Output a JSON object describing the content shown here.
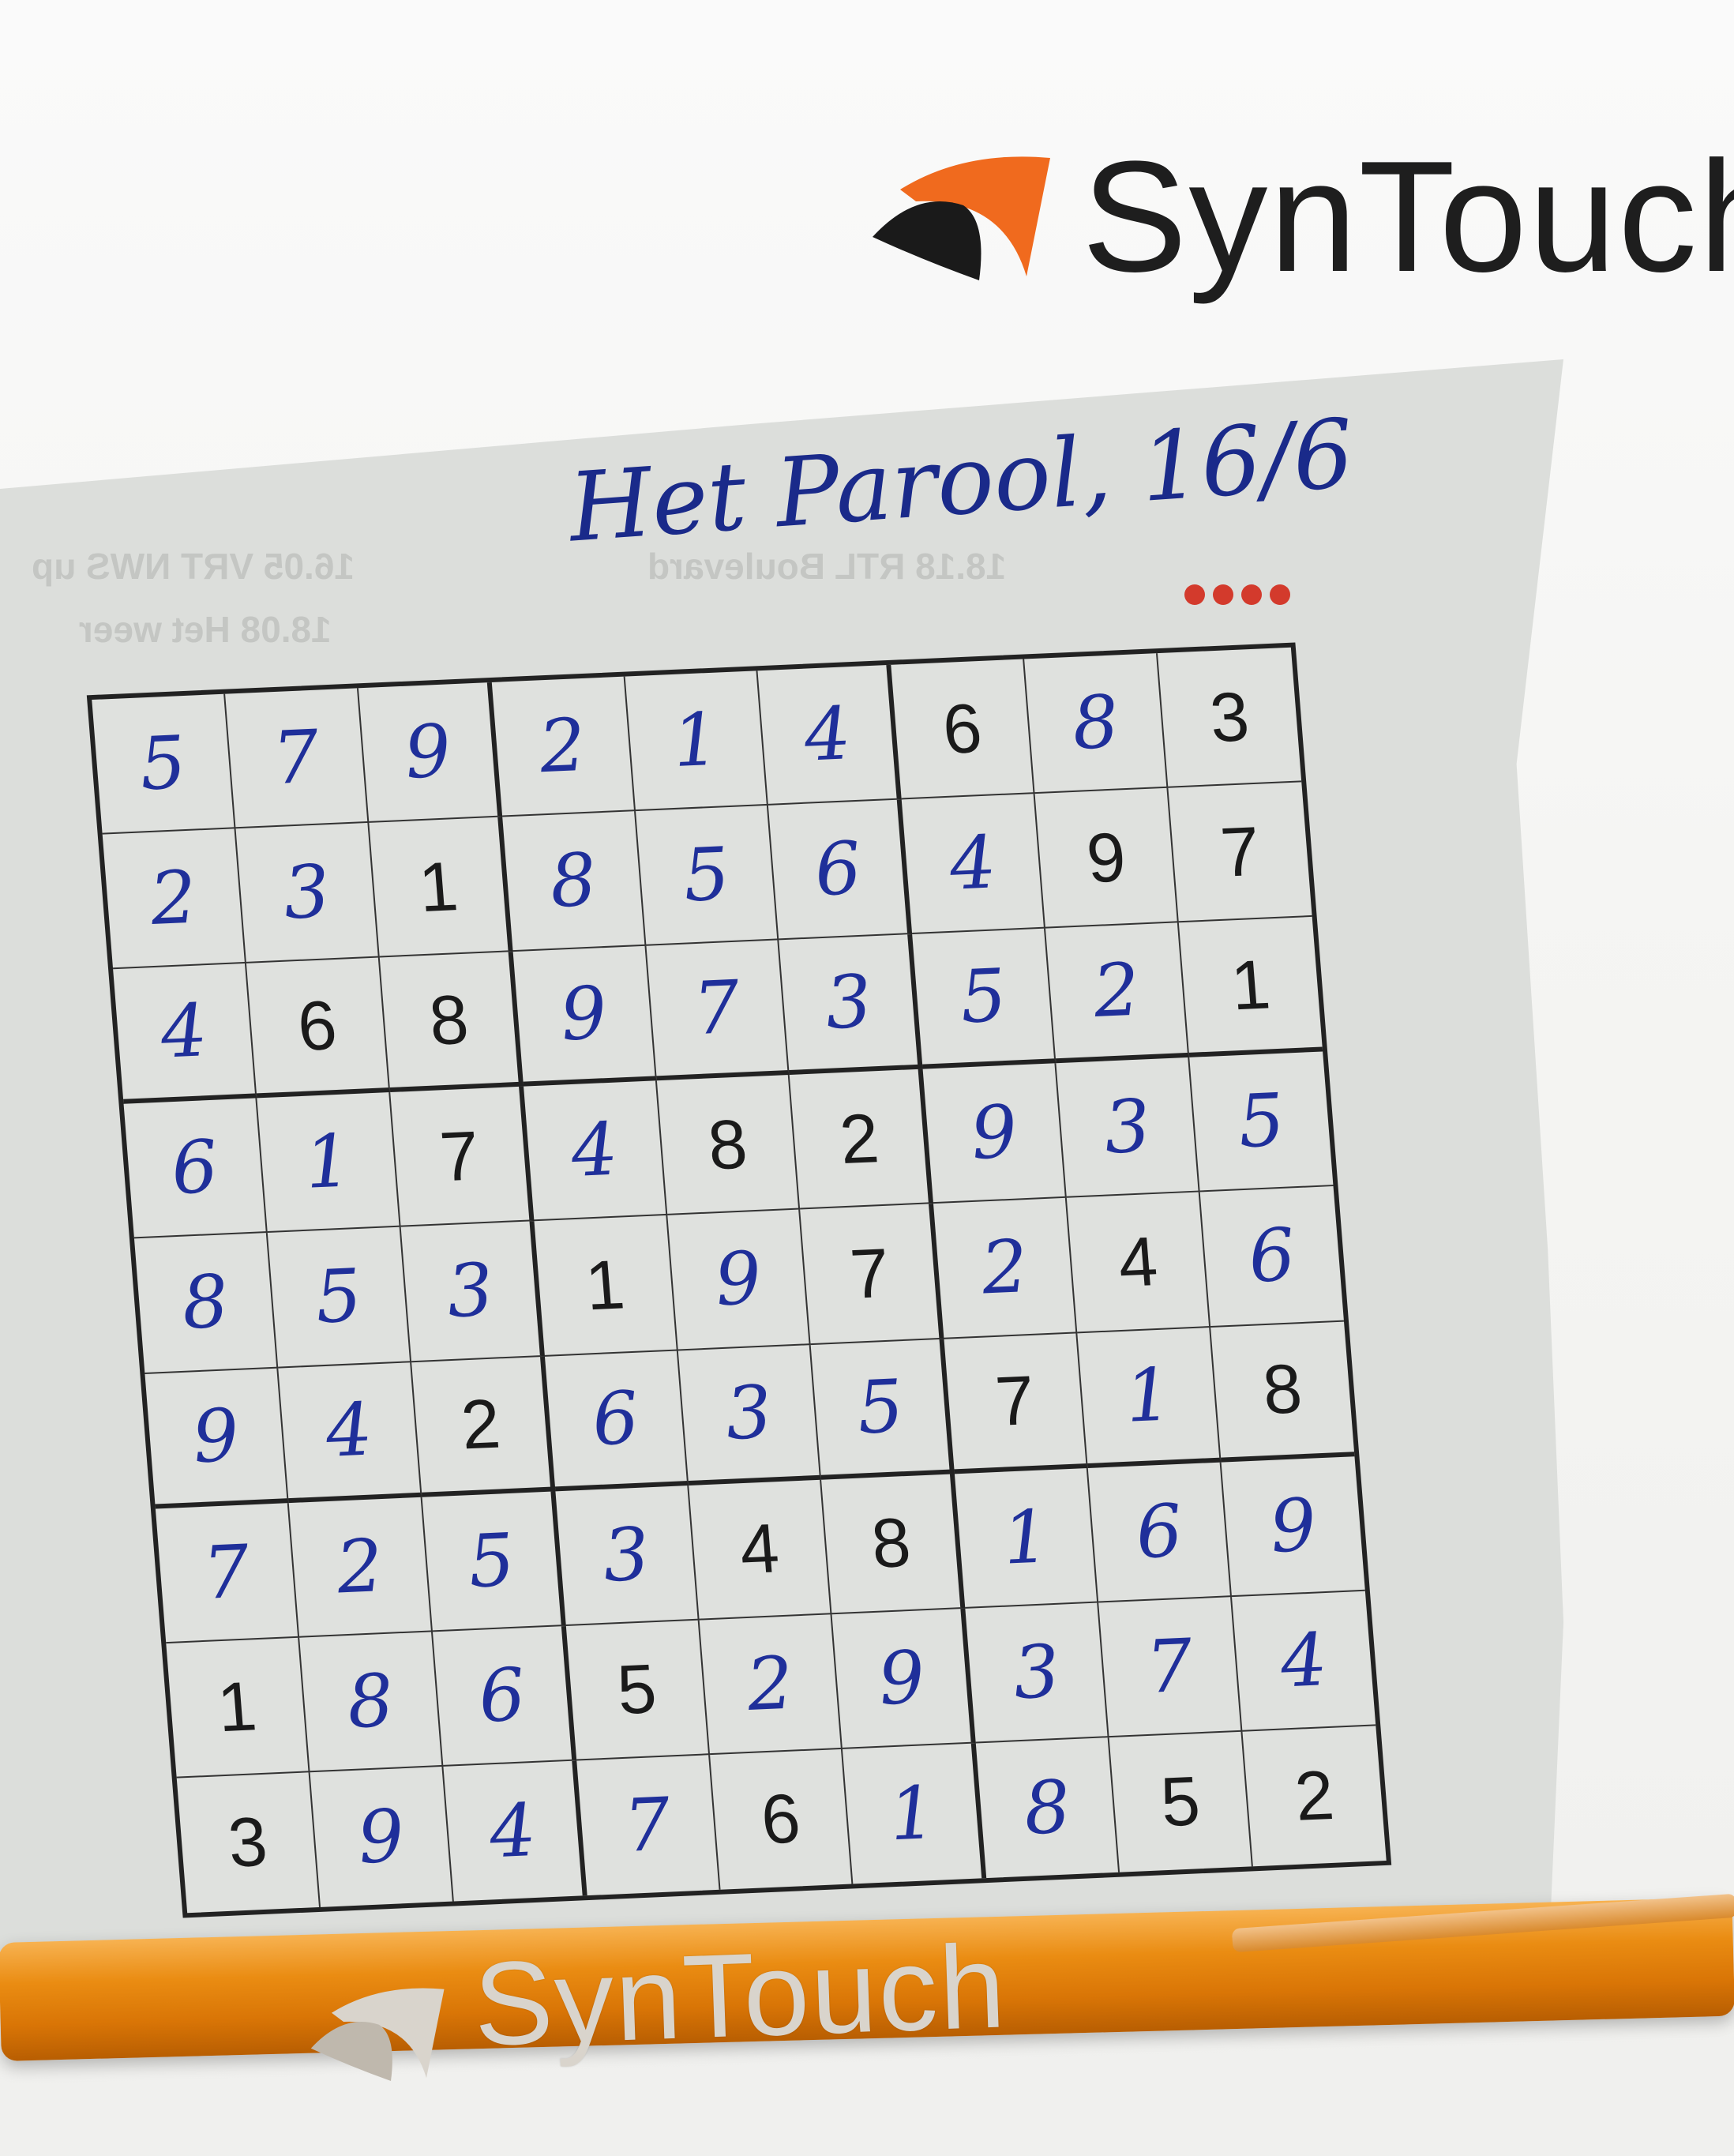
{
  "letterhead": {
    "brand": "SynTouch",
    "logo_accent": "#f06a1e",
    "logo_dark": "#1a1a1a"
  },
  "clipping": {
    "title": "Het Parool, 16/6",
    "difficulty_dots": 4,
    "ink_color": "#1f2f9a",
    "dot_color": "#d33a2c"
  },
  "sudoku": {
    "rows": [
      [
        "5",
        "7",
        "9",
        "2",
        "1",
        "4",
        "6",
        "8",
        "3"
      ],
      [
        "2",
        "3",
        "1",
        "8",
        "5",
        "6",
        "4",
        "9",
        "7"
      ],
      [
        "4",
        "6",
        "8",
        "9",
        "7",
        "3",
        "5",
        "2",
        "1"
      ],
      [
        "6",
        "1",
        "7",
        "4",
        "8",
        "2",
        "9",
        "3",
        "5"
      ],
      [
        "8",
        "5",
        "3",
        "1",
        "9",
        "7",
        "2",
        "4",
        "6"
      ],
      [
        "9",
        "4",
        "2",
        "6",
        "3",
        "5",
        "7",
        "1",
        "8"
      ],
      [
        "7",
        "2",
        "5",
        "3",
        "4",
        "8",
        "1",
        "6",
        "9"
      ],
      [
        "1",
        "8",
        "6",
        "5",
        "2",
        "9",
        "3",
        "7",
        "4"
      ],
      [
        "3",
        "9",
        "4",
        "7",
        "6",
        "1",
        "8",
        "5",
        "2"
      ]
    ],
    "printed_mask": [
      [
        0,
        0,
        0,
        0,
        0,
        0,
        1,
        0,
        1
      ],
      [
        0,
        0,
        1,
        0,
        0,
        0,
        0,
        1,
        1
      ],
      [
        0,
        1,
        1,
        0,
        0,
        0,
        0,
        0,
        1
      ],
      [
        0,
        0,
        1,
        0,
        1,
        1,
        0,
        0,
        0
      ],
      [
        0,
        0,
        0,
        1,
        0,
        1,
        0,
        1,
        0
      ],
      [
        0,
        0,
        1,
        0,
        0,
        0,
        1,
        0,
        1
      ],
      [
        0,
        0,
        0,
        0,
        1,
        1,
        0,
        0,
        0
      ],
      [
        1,
        0,
        0,
        1,
        0,
        0,
        0,
        0,
        0
      ],
      [
        1,
        0,
        0,
        0,
        1,
        0,
        0,
        1,
        1
      ]
    ]
  },
  "pen": {
    "brand": "SynTouch",
    "color": "#ea8c12"
  }
}
